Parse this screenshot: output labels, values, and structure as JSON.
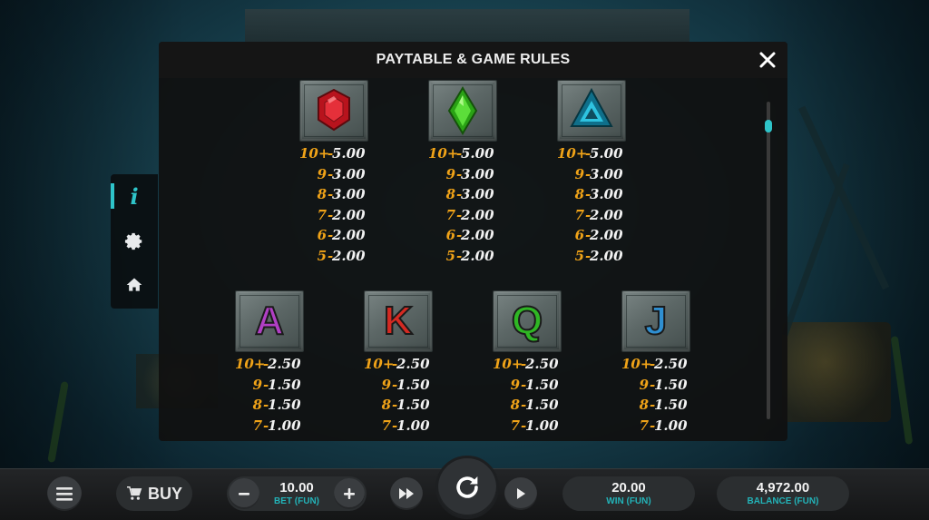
{
  "modal": {
    "title": "PAYTABLE & GAME RULES",
    "close_icon": "close-icon"
  },
  "side_menu": {
    "items": [
      {
        "name": "info",
        "icon": "info-icon",
        "glyph": "i",
        "active": true
      },
      {
        "name": "settings",
        "icon": "gear-icon",
        "active": false
      },
      {
        "name": "home",
        "icon": "home-icon",
        "active": false
      }
    ]
  },
  "paytable": {
    "gems": [
      {
        "symbol": "ruby",
        "icon": "red-gem-icon",
        "color": "#d4202a",
        "pays": [
          {
            "count": "10+",
            "value": "5.00"
          },
          {
            "count": "9",
            "value": "3.00"
          },
          {
            "count": "8",
            "value": "3.00"
          },
          {
            "count": "7",
            "value": "2.00"
          },
          {
            "count": "6",
            "value": "2.00"
          },
          {
            "count": "5",
            "value": "2.00"
          }
        ]
      },
      {
        "symbol": "emerald",
        "icon": "green-gem-icon",
        "color": "#34c21c",
        "pays": [
          {
            "count": "10+",
            "value": "5.00"
          },
          {
            "count": "9",
            "value": "3.00"
          },
          {
            "count": "8",
            "value": "3.00"
          },
          {
            "count": "7",
            "value": "2.00"
          },
          {
            "count": "6",
            "value": "2.00"
          },
          {
            "count": "5",
            "value": "2.00"
          }
        ]
      },
      {
        "symbol": "sapphire",
        "icon": "blue-triangle-gem-icon",
        "color": "#1ba7c4",
        "pays": [
          {
            "count": "10+",
            "value": "5.00"
          },
          {
            "count": "9",
            "value": "3.00"
          },
          {
            "count": "8",
            "value": "3.00"
          },
          {
            "count": "7",
            "value": "2.00"
          },
          {
            "count": "6",
            "value": "2.00"
          },
          {
            "count": "5",
            "value": "2.00"
          }
        ]
      }
    ],
    "letters": [
      {
        "symbol": "A",
        "color": "#b03fc4",
        "pays": [
          {
            "count": "10+",
            "value": "2.50"
          },
          {
            "count": "9",
            "value": "1.50"
          },
          {
            "count": "8",
            "value": "1.50"
          },
          {
            "count": "7",
            "value": "1.00"
          }
        ]
      },
      {
        "symbol": "K",
        "color": "#d42a22",
        "pays": [
          {
            "count": "10+",
            "value": "2.50"
          },
          {
            "count": "9",
            "value": "1.50"
          },
          {
            "count": "8",
            "value": "1.50"
          },
          {
            "count": "7",
            "value": "1.00"
          }
        ]
      },
      {
        "symbol": "Q",
        "color": "#2fb624",
        "pays": [
          {
            "count": "10+",
            "value": "2.50"
          },
          {
            "count": "9",
            "value": "1.50"
          },
          {
            "count": "8",
            "value": "1.50"
          },
          {
            "count": "7",
            "value": "1.00"
          }
        ]
      },
      {
        "symbol": "J",
        "color": "#2f8fd1",
        "pays": [
          {
            "count": "10+",
            "value": "2.50"
          },
          {
            "count": "9",
            "value": "1.50"
          },
          {
            "count": "8",
            "value": "1.50"
          },
          {
            "count": "7",
            "value": "1.00"
          }
        ]
      }
    ]
  },
  "bottom_bar": {
    "menu_icon": "hamburger-menu-icon",
    "buy_label": "BUY",
    "buy_icon": "cart-icon",
    "bet": {
      "value": "10.00",
      "label": "BET (FUN)"
    },
    "win": {
      "value": "20.00",
      "label": "WIN (FUN)"
    },
    "balance": {
      "value": "4,972.00",
      "label": "BALANCE (FUN)"
    },
    "decrease_icon": "minus-icon",
    "increase_icon": "plus-icon",
    "turbo_icon": "fast-forward-icon",
    "spin_icon": "spin-refresh-icon",
    "autoplay_icon": "play-icon"
  },
  "colors": {
    "accent": "#2ec4c9",
    "pay_count": "#f0a318",
    "pay_value": "#f2f2f2"
  }
}
